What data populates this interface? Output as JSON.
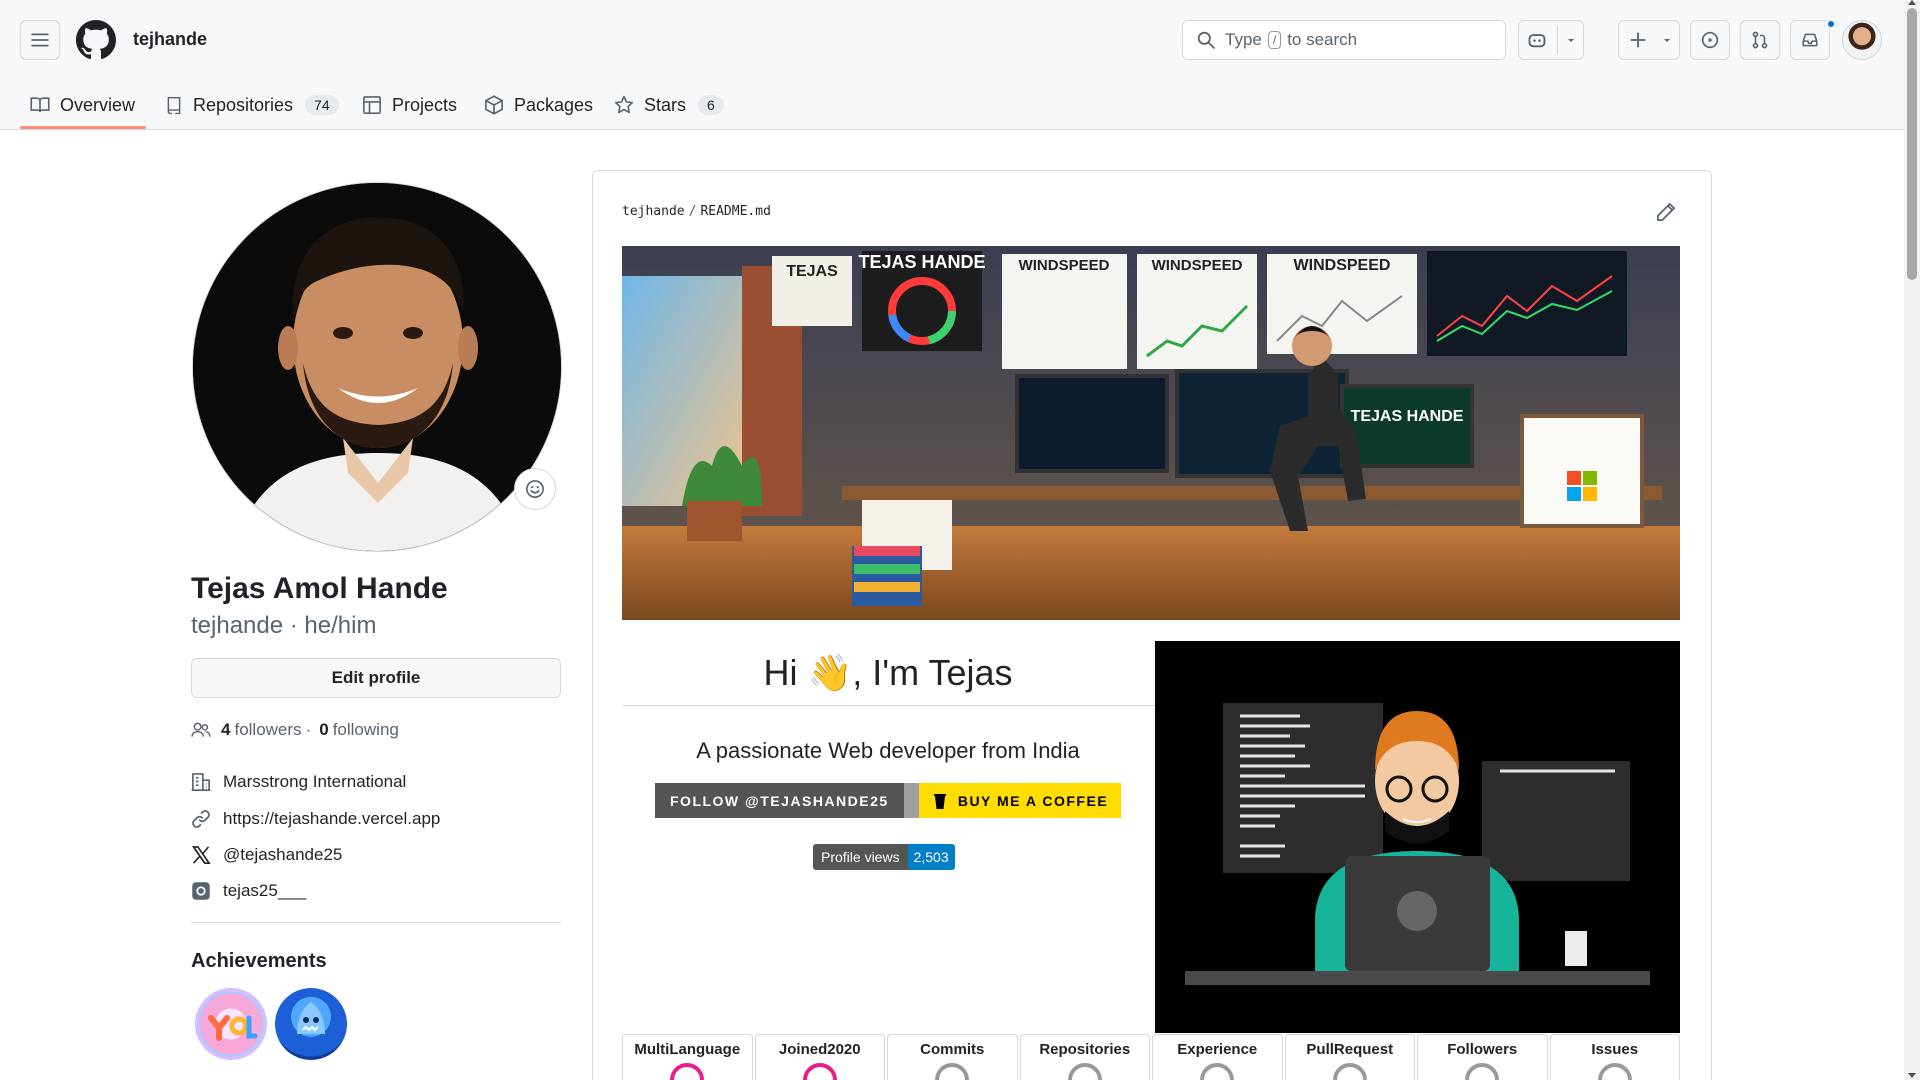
{
  "header": {
    "username": "tejhande",
    "search_prefix": "Type",
    "search_key": "/",
    "search_suffix": "to search"
  },
  "tabs": [
    {
      "label": "Overview",
      "icon": "book-icon"
    },
    {
      "label": "Repositories",
      "count": "74",
      "icon": "repo-icon"
    },
    {
      "label": "Projects",
      "icon": "table-icon"
    },
    {
      "label": "Packages",
      "icon": "package-icon"
    },
    {
      "label": "Stars",
      "count": "6",
      "icon": "star-icon"
    }
  ],
  "profile": {
    "full_name": "Tejas Amol Hande",
    "login_pronouns": "tejhande · he/him",
    "edit_label": "Edit profile",
    "followers_count": "4",
    "followers_label": "followers",
    "following_count": "0",
    "following_label": "following",
    "company": "Marsstrong International",
    "website": "https://tejashande.vercel.app",
    "twitter": "@tejashande25",
    "instagram": "tejas25___"
  },
  "achievements": {
    "title": "Achievements",
    "badges": [
      "yolo-badge",
      "shark-badge"
    ]
  },
  "readme": {
    "path_user": "tejhande",
    "path_sep": "/",
    "path_file": "README.md",
    "greeting": "Hi 👋, I'm Tejas",
    "tagline": "A passionate Web developer from India",
    "follow_shield": "FOLLOW @TEJASHANDE25",
    "coffee_shield": "BUY ME A COFFEE",
    "views_label": "Profile views",
    "views_count": "2,503",
    "banner_words": [
      "TEJAS HANDE",
      "TEJAS",
      "HANDE",
      "WINDSPEED",
      "WINDSPEED",
      "WINDSPEED"
    ],
    "stats": [
      "MultiLanguage",
      "Joined2020",
      "Commits",
      "Repositories",
      "Experience",
      "PullRequest",
      "Followers",
      "Issues"
    ]
  },
  "colors": {
    "accent_underline": "#fd8c73",
    "coffee_yellow": "#ffdd00",
    "views_blue": "#007ec6",
    "shield_gray": "#555555"
  }
}
